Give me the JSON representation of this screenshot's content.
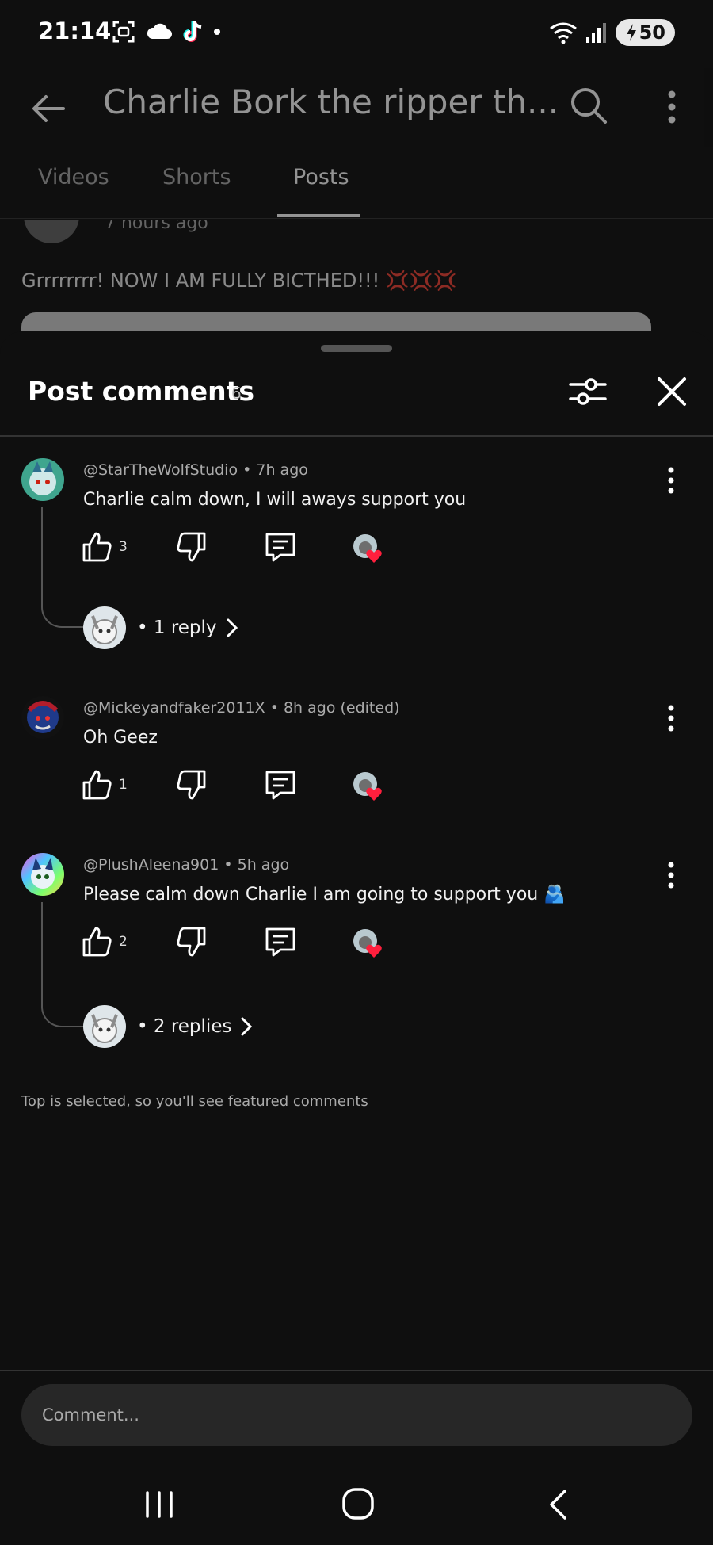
{
  "status_bar": {
    "time": "21:14",
    "battery_level": "50",
    "icons": [
      "screenshot-icon",
      "cloud-icon",
      "tiktok-icon",
      "dot-icon",
      "wifi-icon",
      "signal-icon",
      "battery-icon"
    ]
  },
  "channel": {
    "title": "Charlie Bork the ripper th...",
    "tabs": [
      {
        "label": "Videos",
        "active": false
      },
      {
        "label": "Shorts",
        "active": false
      },
      {
        "label": "Posts",
        "active": true
      }
    ],
    "post_time": "7 hours ago",
    "post_text": "Grrrrrrrr! NOW I AM FULLY BICTHED!!! 💢💢💢"
  },
  "comments_sheet": {
    "title": "Post comments",
    "count": "6",
    "comments": [
      {
        "author": "@StarTheWolfStudio",
        "time": "7h ago",
        "text": "Charlie calm down, I will aways support you",
        "likes": "3",
        "creator_hearted": true,
        "replies_label": "1 reply",
        "avatar_color": "#3fa58e"
      },
      {
        "author": "@Mickeyandfaker2011X",
        "time": "8h ago (edited)",
        "text": "Oh Geez",
        "likes": "1",
        "creator_hearted": true,
        "replies_label": "",
        "avatar_color": "#1f3a8a"
      },
      {
        "author": "@PlushAleena901",
        "time": "5h ago",
        "text": "Please calm down Charlie I am going to support you 🫂",
        "likes": "2",
        "creator_hearted": true,
        "replies_label": "2 replies",
        "avatar_color": "#2e7d32"
      }
    ],
    "footer_note": "Top is selected, so you'll see featured comments",
    "input_placeholder": "Comment..."
  },
  "colors": {
    "background": "#0f0f0f",
    "heart_red": "#ff1f3d",
    "sheet_divider": "#333333"
  }
}
